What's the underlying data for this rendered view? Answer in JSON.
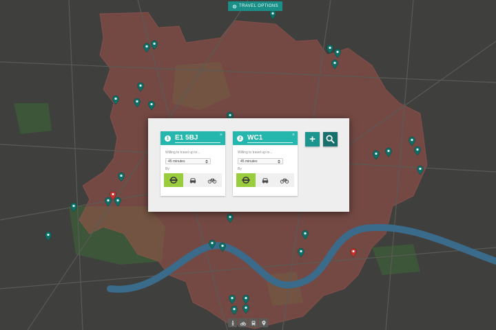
{
  "top_bar": {
    "travel_options_label": "TRAVEL OPTIONS"
  },
  "locations": [
    {
      "number": "1",
      "value": "E1 5BJ",
      "close_label": "×",
      "willing_label": "Willing to travel up to...",
      "time_selected": "45 minutes",
      "by_label": "By",
      "active_mode": "public-transport"
    },
    {
      "number": "2",
      "value": "WC1",
      "close_label": "×",
      "willing_label": "Willing to travel up to...",
      "time_selected": "45 minutes",
      "by_label": "By",
      "active_mode": "public-transport"
    }
  ],
  "transport_modes": [
    "underground-icon",
    "car-icon",
    "bicycle-icon"
  ],
  "actions": {
    "add_label": "+",
    "search_icon": "search-icon"
  },
  "bottom_toolbar": [
    "walk-icon",
    "cycle-icon",
    "transit-icon",
    "pin-icon"
  ],
  "map_pins": [
    {
      "id": "pin-green",
      "kind": "venue",
      "color": "#0f6e66"
    },
    {
      "id": "pin-red",
      "kind": "highlight",
      "color": "#c9302c"
    }
  ],
  "colors": {
    "accent": "#25b6ad",
    "accent_dark": "#1c958e",
    "active_mode": "#9acd3e",
    "zone_fill": "#a8524a",
    "river": "#3a6b8a",
    "park": "#3b5a35",
    "pin": "#0f6e66",
    "pin_alert": "#c9302c"
  }
}
